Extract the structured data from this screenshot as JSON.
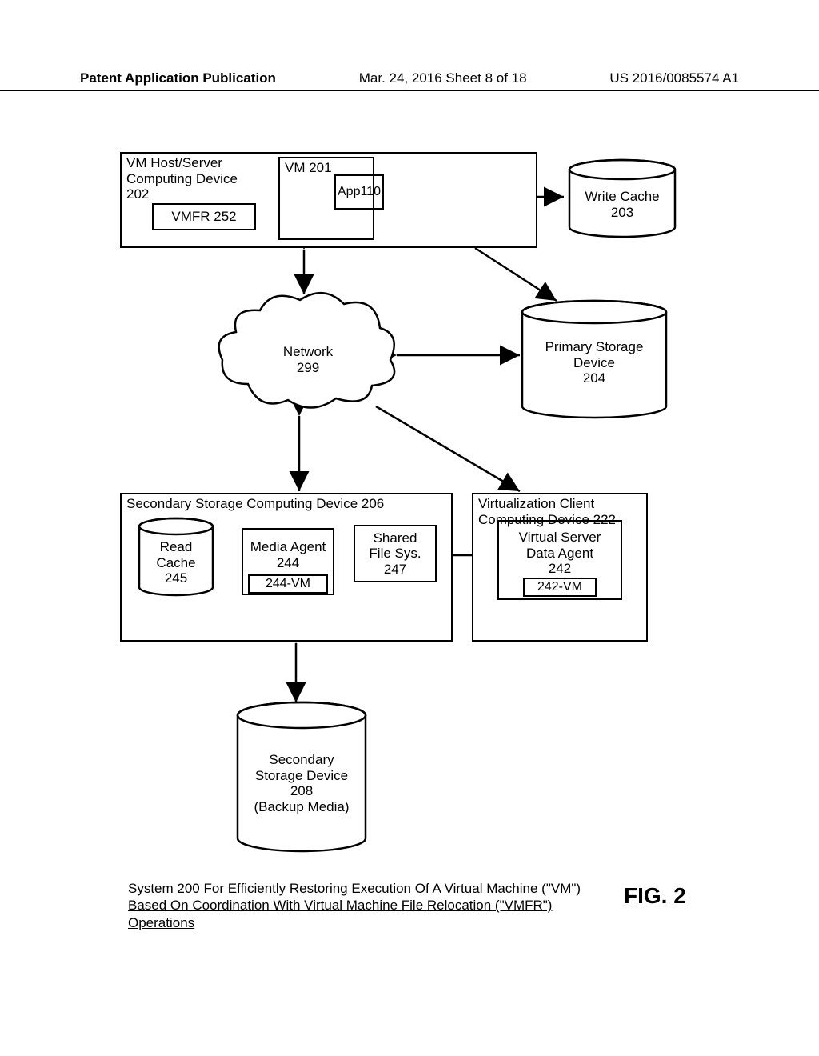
{
  "header": {
    "left": "Patent Application Publication",
    "center": "Mar. 24, 2016  Sheet 8 of 18",
    "right": "US 2016/0085574 A1"
  },
  "host": {
    "title_l1": "VM Host/Server",
    "title_l2": "Computing Device",
    "title_l3": "202",
    "vmfr": "VMFR 252",
    "vm201": "VM 201",
    "app_l1": "App",
    "app_l2": "110"
  },
  "write_cache": {
    "l1": "Write Cache",
    "l2": "203"
  },
  "primary_storage": {
    "l1": "Primary Storage",
    "l2": "Device",
    "l3": "204"
  },
  "network": {
    "l1": "Network",
    "l2": "299"
  },
  "sscd": {
    "title": "Secondary Storage Computing Device 206"
  },
  "read_cache": {
    "l1": "Read",
    "l2": "Cache",
    "l3": "245"
  },
  "media_agent": {
    "l1": "Media Agent",
    "l2": "244",
    "vm": "244-VM"
  },
  "sfs": {
    "l1": "Shared",
    "l2": "File Sys.",
    "l3": "247"
  },
  "vccd": {
    "l1": "Virtualization Client",
    "l2": "Computing Device 222"
  },
  "vsda": {
    "l1": "Virtual Server",
    "l2": "Data Agent",
    "l3": "242",
    "vm": "242-VM"
  },
  "secondary_storage": {
    "l1": "Secondary",
    "l2": "Storage Device",
    "l3": "208",
    "l4": "(Backup Media)"
  },
  "caption": "System 200 For Efficiently Restoring Execution Of A Virtual Machine (\"VM\") Based On Coordination With Virtual Machine File Relocation (\"VMFR\") Operations",
  "figure": "FIG. 2"
}
